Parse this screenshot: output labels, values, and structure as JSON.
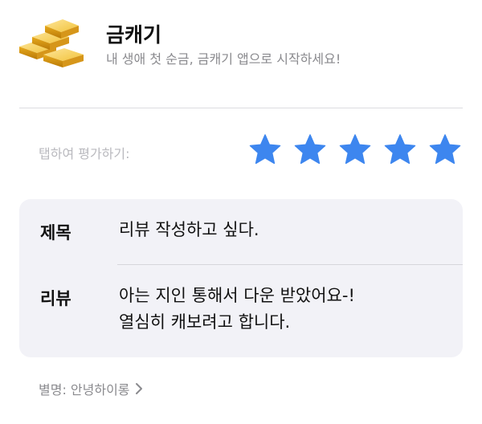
{
  "app": {
    "name": "금캐기",
    "subtitle": "내 생애 첫 순금, 금캐기 앱으로 시작하세요!",
    "icon": "gold-bars-icon"
  },
  "rating": {
    "label": "탭하여 평가하기:",
    "stars": 5,
    "max": 5,
    "star_color": "#3d86ef"
  },
  "review": {
    "title_label": "제목",
    "title_value": "리뷰 작성하고 싶다.",
    "body_label": "리뷰",
    "body_line1": "아는 지인 통해서 다운 받았어요-!",
    "body_line2": "열심히 캐보려고 합니다."
  },
  "nickname": {
    "text": "별명: 안녕하이롱",
    "icon": "chevron-right-icon"
  }
}
